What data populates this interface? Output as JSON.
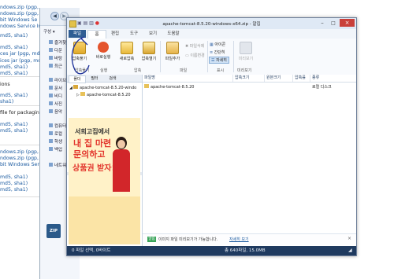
{
  "background_page": {
    "lines": [
      {
        "text": "ndows.zip (pgp,",
        "dark": false
      },
      {
        "text": "ndows.zip (pgp, md5, sha1)",
        "dark": false
      },
      {
        "text": "bit Windows Se",
        "dark": false
      },
      {
        "text": "ndows Service Installe",
        "dark": false
      },
      {
        "text": "md5, sha1)",
        "dark": false
      },
      {
        "text": "md5, sha1)",
        "dark": false
      },
      {
        "text": "ces jar (pgp, md5",
        "dark": false
      },
      {
        "text": "ices jar (pgp, md",
        "dark": false
      },
      {
        "text": "md5, sha1)",
        "dark": false
      },
      {
        "text": "md5, sha1)",
        "dark": false
      },
      {
        "text": "ions",
        "dark": true
      },
      {
        "text": "md5, sha1)",
        "dark": false
      },
      {
        "text": "sha1)",
        "dark": false
      },
      {
        "text": "file for packagin",
        "dark": true
      },
      {
        "text": "md5, sha1)",
        "dark": false
      },
      {
        "text": "md5, sha1)",
        "dark": false
      },
      {
        "text": "ndows.zip (pgp, md5, sha1)",
        "dark": false
      },
      {
        "text": "ndows.zip (pgp, md5, sha1)",
        "dark": false
      },
      {
        "text": "bit Windows Service Installer",
        "dark": false
      },
      {
        "text": "md5, sha1)",
        "dark": false
      },
      {
        "text": "md5, sha1)",
        "dark": false
      },
      {
        "text": "md5, sha1)",
        "dark": false
      }
    ]
  },
  "explorer": {
    "organize_label": "구성 ▾",
    "nav_items": [
      "즐겨찾",
      "다운",
      "바탕",
      "최근",
      "라이브",
      "문서",
      "비디",
      "사진",
      "음악",
      "컴퓨터",
      "로컬",
      "학생",
      "백업",
      "네트워"
    ]
  },
  "window": {
    "title": "apache-tomcat-8.5.20-windows-x64.zip - 알집",
    "ribbon_tabs": [
      "파일",
      "홈",
      "편집",
      "도구",
      "보기",
      "도움말"
    ],
    "ribbon_buttons": [
      {
        "label": "압축풀기",
        "icon": "extract-icon"
      },
      {
        "label": "바로실행",
        "icon": "play-icon"
      },
      {
        "label": "새로압축",
        "icon": "new-archive-icon"
      },
      {
        "label": "압축열기",
        "icon": "open-archive-icon"
      },
      {
        "label": "파일추가",
        "icon": "add-file-icon"
      }
    ],
    "ribbon_small_buttons": [
      "파일삭제",
      "이름변경"
    ],
    "view_buttons": [
      "아이콘",
      "간단히",
      "자세히"
    ],
    "view_extra": "미리보기",
    "groups": [
      "압축풀기",
      "실행",
      "압축",
      "파일",
      "표시",
      "미리보기"
    ],
    "left_tabs": [
      "폴더",
      "필터",
      "검색"
    ],
    "tree": {
      "root": "apache-tomcat-8.5.20-windo",
      "child": "apache-tomcat-8.5.20"
    },
    "columns": [
      "파일명",
      "압축크기",
      "원본크기",
      "압축률",
      "종류"
    ],
    "rows": [
      {
        "name": "apache-tomcat-8.5.20",
        "size": "",
        "orig": "",
        "ratio": "",
        "type": "로컬 디스크"
      }
    ],
    "bottom_notice": {
      "badge": "알림",
      "text": "이미지 파일 미리보기가 가능합니다.",
      "link": "자세히 보기"
    },
    "status": {
      "left": "0 파일 선택, 0바이트",
      "right": "총 640파일, 15.0MB"
    },
    "ad": {
      "line1": "서희고집에서",
      "line2": "내 집 마련",
      "line3": "문의하고",
      "line4": "상품권 받자!"
    }
  },
  "taskbar_icon": "ZIP"
}
